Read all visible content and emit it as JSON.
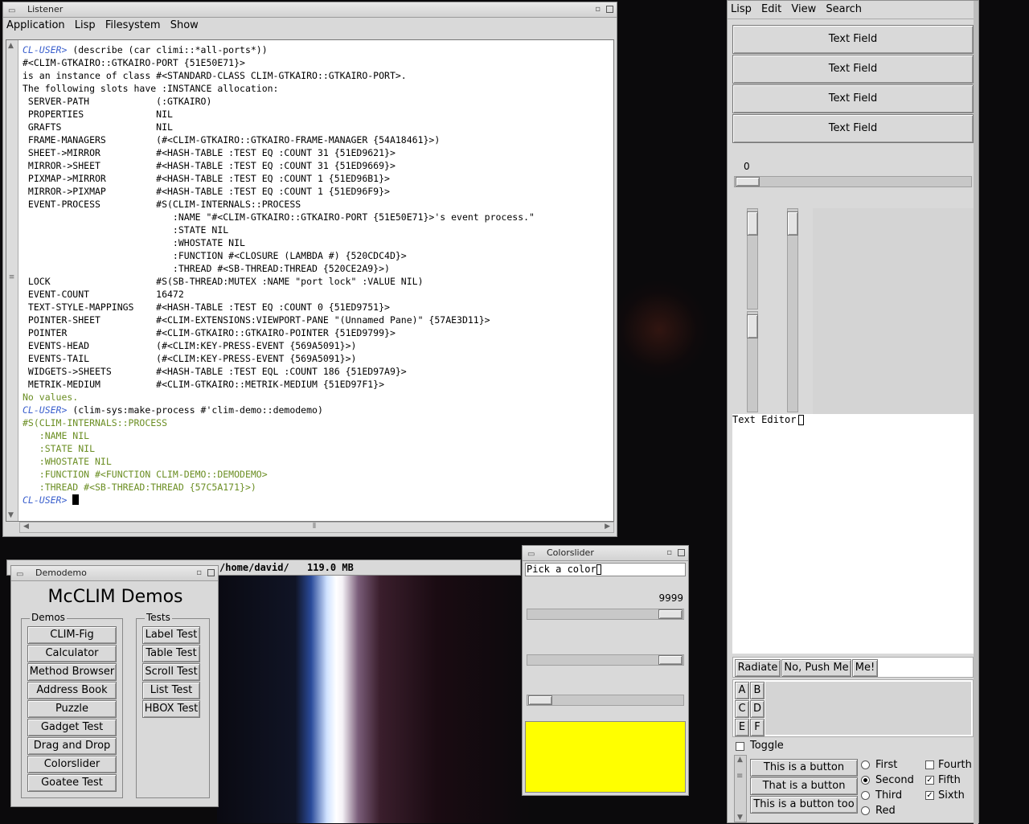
{
  "listener": {
    "title": "Listener",
    "menu": [
      "Application",
      "Lisp",
      "Filesystem",
      "Show"
    ],
    "lines": [
      {
        "prompt": "CL-USER>",
        "text": " (describe (car climi::*all-ports*))",
        "color": "#000000"
      },
      {
        "text": "#<CLIM-GTKAIRO::GTKAIRO-PORT {51E50E71}>",
        "color": "#000000"
      },
      {
        "text": "is an instance of class #<STANDARD-CLASS CLIM-GTKAIRO::GTKAIRO-PORT>.",
        "color": "#000000"
      },
      {
        "text": "The following slots have :INSTANCE allocation:",
        "color": "#000000"
      },
      {
        "text": " SERVER-PATH            (:GTKAIRO)",
        "color": "#000000"
      },
      {
        "text": " PROPERTIES             NIL",
        "color": "#000000"
      },
      {
        "text": " GRAFTS                 NIL",
        "color": "#000000"
      },
      {
        "text": " FRAME-MANAGERS         (#<CLIM-GTKAIRO::GTKAIRO-FRAME-MANAGER {54A18461}>)",
        "color": "#000000"
      },
      {
        "text": " SHEET->MIRROR          #<HASH-TABLE :TEST EQ :COUNT 31 {51ED9621}>",
        "color": "#000000"
      },
      {
        "text": " MIRROR->SHEET          #<HASH-TABLE :TEST EQ :COUNT 31 {51ED9669}>",
        "color": "#000000"
      },
      {
        "text": " PIXMAP->MIRROR         #<HASH-TABLE :TEST EQ :COUNT 1 {51ED96B1}>",
        "color": "#000000"
      },
      {
        "text": " MIRROR->PIXMAP         #<HASH-TABLE :TEST EQ :COUNT 1 {51ED96F9}>",
        "color": "#000000"
      },
      {
        "text": " EVENT-PROCESS          #S(CLIM-INTERNALS::PROCESS",
        "color": "#000000"
      },
      {
        "text": "                           :NAME \"#<CLIM-GTKAIRO::GTKAIRO-PORT {51E50E71}>'s event process.\"",
        "color": "#000000"
      },
      {
        "text": "                           :STATE NIL",
        "color": "#000000"
      },
      {
        "text": "                           :WHOSTATE NIL",
        "color": "#000000"
      },
      {
        "text": "                           :FUNCTION #<CLOSURE (LAMBDA #) {520CDC4D}>",
        "color": "#000000"
      },
      {
        "text": "                           :THREAD #<SB-THREAD:THREAD {520CE2A9}>)",
        "color": "#000000"
      },
      {
        "text": " LOCK                   #S(SB-THREAD:MUTEX :NAME \"port lock\" :VALUE NIL)",
        "color": "#000000"
      },
      {
        "text": " EVENT-COUNT            16472",
        "color": "#000000"
      },
      {
        "text": " TEXT-STYLE-MAPPINGS    #<HASH-TABLE :TEST EQ :COUNT 0 {51ED9751}>",
        "color": "#000000"
      },
      {
        "text": " POINTER-SHEET          #<CLIM-EXTENSIONS:VIEWPORT-PANE \"(Unnamed Pane)\" {57AE3D11}>",
        "color": "#000000"
      },
      {
        "text": " POINTER                #<CLIM-GTKAIRO::GTKAIRO-POINTER {51ED9799}>",
        "color": "#000000"
      },
      {
        "text": " EVENTS-HEAD            (#<CLIM:KEY-PRESS-EVENT {569A5091}>)",
        "color": "#000000"
      },
      {
        "text": " EVENTS-TAIL            (#<CLIM:KEY-PRESS-EVENT {569A5091}>)",
        "color": "#000000"
      },
      {
        "text": " WIDGETS->SHEETS        #<HASH-TABLE :TEST EQL :COUNT 186 {51ED97A9}>",
        "color": "#000000"
      },
      {
        "text": " METRIK-MEDIUM          #<CLIM-GTKAIRO::METRIK-MEDIUM {51ED97F1}>",
        "color": "#000000"
      },
      {
        "text": "No values.",
        "color": "#6b8e23"
      },
      {
        "prompt": "CL-USER>",
        "text": " (clim-sys:make-process #'clim-demo::demodemo)",
        "color": "#000000"
      },
      {
        "text": "#S(CLIM-INTERNALS::PROCESS",
        "color": "#6b8e23"
      },
      {
        "text": "   :NAME NIL",
        "color": "#6b8e23"
      },
      {
        "text": "   :STATE NIL",
        "color": "#6b8e23"
      },
      {
        "text": "   :WHOSTATE NIL",
        "color": "#6b8e23"
      },
      {
        "text": "   :FUNCTION #<FUNCTION CLIM-DEMO::DEMODEMO>",
        "color": "#6b8e23"
      },
      {
        "text": "   :THREAD #<SB-THREAD:THREAD {57C5A171}>)",
        "color": "#6b8e23"
      },
      {
        "prompt": "CL-USER>",
        "text": " ",
        "color": "#000000",
        "cursor": true
      }
    ],
    "status_path": "/home/david/",
    "status_mem": "119.0 MB"
  },
  "gadgets": {
    "menu": [
      "Lisp",
      "Edit",
      "View",
      "Search"
    ],
    "text_fields": [
      "Text Field",
      "Text Field",
      "Text Field",
      "Text Field"
    ],
    "slider_value": "0",
    "text_editor_label": "Text Editor",
    "push_buttons": [
      "Radiate",
      "No, Push Me",
      "Me!"
    ],
    "grid_buttons": [
      "A",
      "B",
      "C",
      "D",
      "E",
      "F"
    ],
    "toggle_label": "Toggle",
    "buttons": [
      "This is a button",
      "That is a button",
      "This is a button too"
    ],
    "radios": [
      {
        "label": "First",
        "checked": false
      },
      {
        "label": "Second",
        "checked": true
      },
      {
        "label": "Third",
        "checked": false
      },
      {
        "label": "Red",
        "checked": false
      }
    ],
    "checks": [
      {
        "label": "Fourth",
        "checked": false
      },
      {
        "label": "Fifth",
        "checked": true
      },
      {
        "label": "Sixth",
        "checked": true
      }
    ]
  },
  "colorslider": {
    "title": "Colorslider",
    "input_value": "Pick a color",
    "value": "9999",
    "swatch_color": "#ffff00"
  },
  "demodemo": {
    "title": "Demodemo",
    "heading": "McCLIM Demos",
    "demos_label": "Demos",
    "tests_label": "Tests",
    "demos": [
      "CLIM-Fig",
      "Calculator",
      "Method Browser",
      "Address Book",
      "Puzzle",
      "Gadget Test",
      "Drag and Drop",
      "Colorslider",
      "Goatee Test"
    ],
    "tests": [
      "Label Test",
      "Table Test",
      "Scroll Test",
      "List Test",
      "HBOX Test"
    ]
  }
}
